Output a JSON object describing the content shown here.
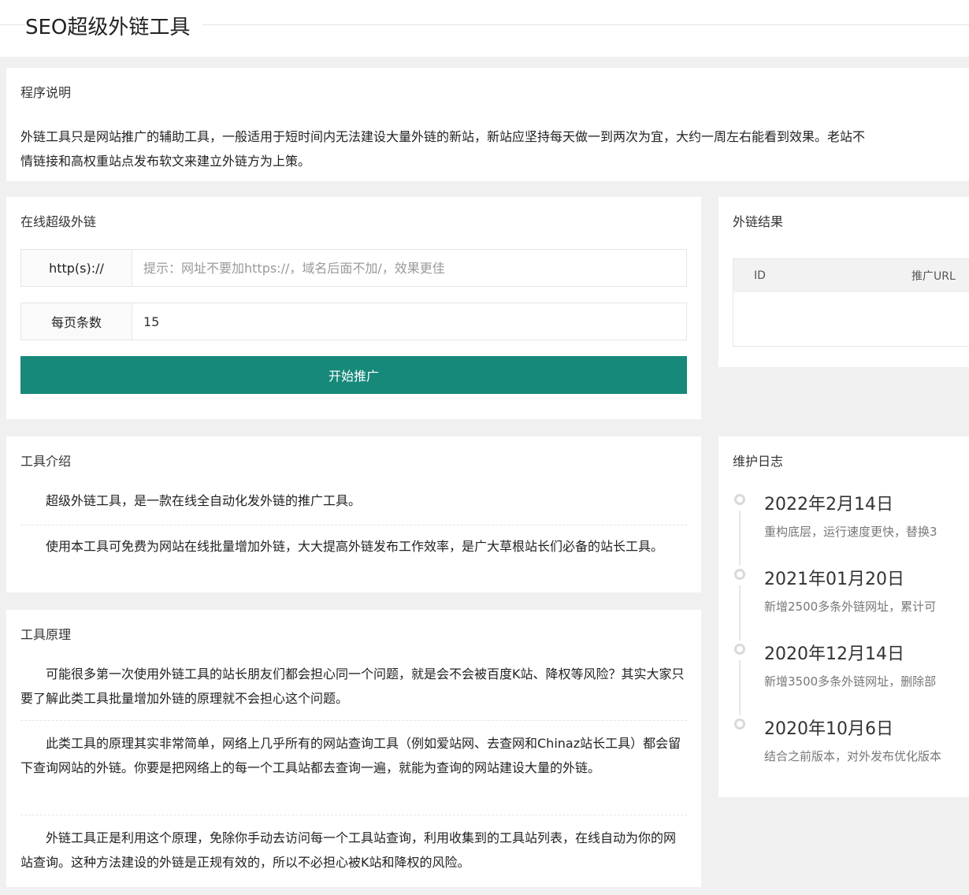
{
  "header": {
    "title": "SEO超级外链工具"
  },
  "intro": {
    "title": "程序说明",
    "line1": "外链工具只是网站推广的辅助工具，一般适用于短时间内无法建设大量外链的新站，新站应坚持每天做一到两次为宜，大约一周左右能看到效果。老站不",
    "line2": "情链接和高权重站点发布软文来建立外链方为上策。"
  },
  "online": {
    "title": "在线超级外链",
    "url_label": "http(s)://",
    "url_placeholder": "提示：网址不要加https://，域名后面不加/，效果更佳",
    "per_page_label": "每页条数",
    "per_page_value": "15",
    "start_button": "开始推广"
  },
  "results": {
    "title": "外链结果",
    "columns": [
      "ID",
      "推广URL"
    ]
  },
  "tool_intro": {
    "title": "工具介绍",
    "paragraphs": [
      "超级外链工具，是一款在线全自动化发外链的推广工具。",
      "使用本工具可免费为网站在线批量增加外链，大大提高外链发布工作效率，是广大草根站长们必备的站长工具。"
    ]
  },
  "principle": {
    "title": "工具原理",
    "paragraphs": [
      "可能很多第一次使用外链工具的站长朋友们都会担心同一个问题，就是会不会被百度K站、降权等风险？其实大家只要了解此类工具批量增加外链的原理就不会担心这个问题。",
      "此类工具的原理其实非常简单，网络上几乎所有的网站查询工具（例如爱站网、去查网和Chinaz站长工具）都会留下查询网站的外链。你要是把网络上的每一个工具站都去查询一遍，就能为查询的网站建设大量的外链。",
      "外链工具正是利用这个原理，免除你手动去访问每一个工具站查询，利用收集到的工具站列表，在线自动为你的网站查询。这种方法建设的外链是正规有效的，所以不必担心被K站和降权的风险。"
    ]
  },
  "changelog": {
    "title": "维护日志",
    "items": [
      {
        "date": "2022年2月14日",
        "desc": "重构底层，运行速度更快，替换3"
      },
      {
        "date": "2021年01月20日",
        "desc": "新增2500多条外链网址，累计可"
      },
      {
        "date": "2020年12月14日",
        "desc": "新增3500多条外链网址，删除部"
      },
      {
        "date": "2020年10月6日",
        "desc": "结合之前版本，对外发布优化版本"
      }
    ]
  }
}
